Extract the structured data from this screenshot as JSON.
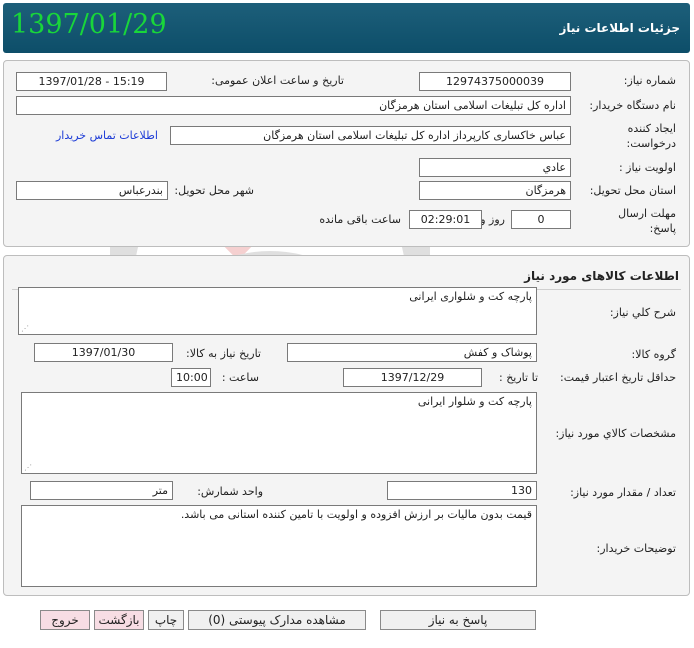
{
  "header": {
    "title": "جزئیات اطلاعات نیاز",
    "date": "1397/01/29"
  },
  "need": {
    "number_label": "شماره نیاز:",
    "number": "12974375000039",
    "announce_label": "تاریخ و ساعت اعلان عمومی:",
    "announce": "1397/01/28 - 15:19",
    "buyer_label": "نام دستگاه خریدار:",
    "buyer": "اداره کل تبلیغات اسلامی استان هرمزگان",
    "creator_label": "ایجاد کننده درخواست:",
    "creator": "عباس  خاکساری  کارپرداز اداره کل تبلیغات اسلامی استان هرمزگان",
    "contact_link": "اطلاعات تماس خریدار",
    "priority_label": "اولویت نیاز :",
    "priority": "عادي",
    "province_label": "استان محل تحویل:",
    "province": "هرمزگان",
    "city_label": "شهر محل تحویل:",
    "city": "بندرعباس",
    "deadline_label": "مهلت ارسال پاسخ:",
    "days": "0",
    "days_label": "روز و",
    "time": "02:29:01",
    "time_label": "ساعت باقی مانده"
  },
  "goods": {
    "section_title": "اطلاعات کالاهای مورد نیاز",
    "desc_label": "شرح کلي نیاز:",
    "desc": "پارچه کت و شلواری ایرانی",
    "group_label": "گروه کالا:",
    "group": "پوشاک و کفش",
    "need_date_label": "تاریخ نیاز به کالا:",
    "need_date": "1397/01/30",
    "validity_label": "حداقل تاریخ اعتبار قیمت:",
    "until_label": "تا تاریخ :",
    "until": "1397/12/29",
    "hour_label": "ساعت :",
    "hour": "10:00",
    "spec_label": "مشخصات کالاي مورد نیاز:",
    "spec": "پارچه کت و شلوار ایرانی",
    "qty_label": "تعداد / مقدار مورد نیاز:",
    "qty": "130",
    "unit_label": "واحد شمارش:",
    "unit": "متر",
    "notes_label": "توضیحات خریدار:",
    "notes": "قیمت بدون مالیات بر ارزش افزوده و اولویت با تامین کننده استانی می باشد."
  },
  "buttons": {
    "reply": "پاسخ به نیاز",
    "attachments": "مشاهده مدارک پیوستی (0)",
    "print": "چاپ",
    "back": "بازگشت",
    "exit": "خروج"
  }
}
